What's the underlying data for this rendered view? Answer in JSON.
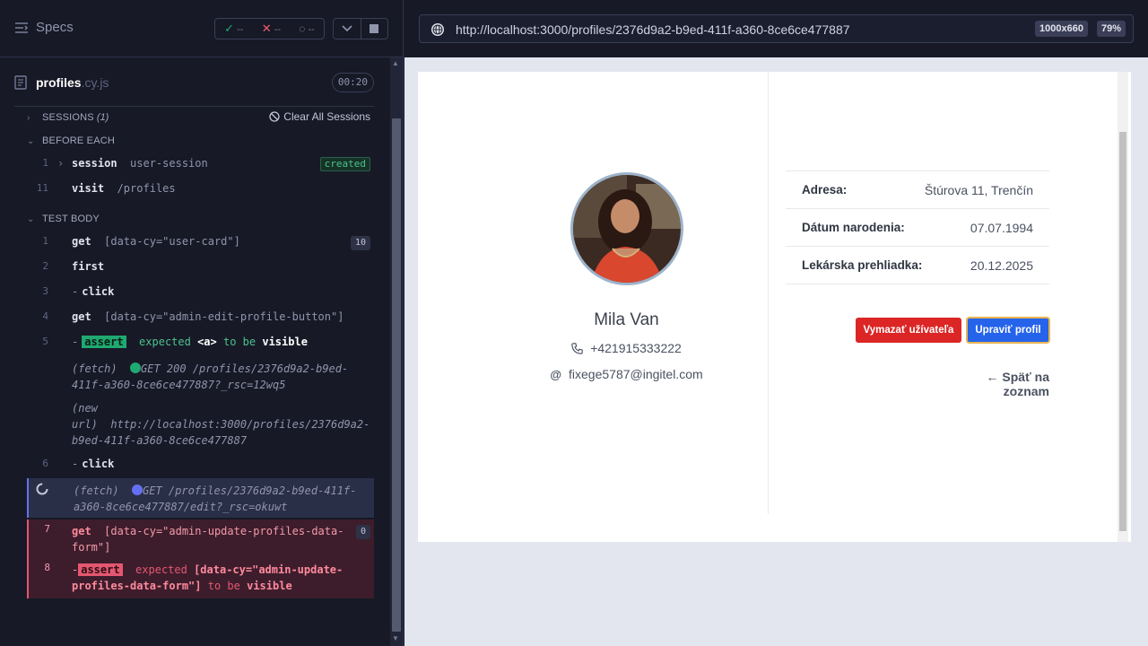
{
  "runner": {
    "specs_label": "Specs",
    "stats": {
      "passed": "--",
      "failed": "--",
      "pending": "--"
    },
    "spec": {
      "name": "profiles",
      "ext": ".cy.js",
      "time": "00:20"
    },
    "sessions": {
      "label": "SESSIONS",
      "count": "(1)",
      "clear_label": "Clear All Sessions"
    },
    "before_each": {
      "label": "BEFORE EACH",
      "commands": [
        {
          "num": "1",
          "cmd": "session",
          "arg": "user-session",
          "badge": "created"
        },
        {
          "num": "11",
          "cmd": "visit",
          "arg": "/profiles"
        }
      ]
    },
    "test_body": {
      "label": "TEST BODY",
      "c1": {
        "num": "1",
        "cmd": "get",
        "arg": "[data-cy=\"user-card\"]",
        "count": "10"
      },
      "c2": {
        "num": "2",
        "cmd": "first"
      },
      "c3": {
        "num": "3",
        "dash": "-",
        "cmd": "click"
      },
      "c4": {
        "num": "4",
        "cmd": "get",
        "arg": "[data-cy=\"admin-edit-profile-button\"]"
      },
      "c5": {
        "num": "5",
        "dash": "-",
        "assert": "assert",
        "expected": "expected",
        "el": "<a>",
        "tobe": "to be",
        "state": "visible"
      },
      "fetch1": {
        "type": "(fetch)",
        "text": "GET 200 /profiles/2376d9a2-b9ed-411f-a360-8ce6ce477887?_rsc=12wq5"
      },
      "newurl": {
        "type": "(new url)",
        "text": "http://localhost:3000/profiles/2376d9a2-b9ed-411f-a360-8ce6ce477887"
      },
      "c6": {
        "num": "6",
        "dash": "-",
        "cmd": "click"
      },
      "fetch2": {
        "type": "(fetch)",
        "text": "GET /profiles/2376d9a2-b9ed-411f-a360-8ce6ce477887/edit?_rsc=okuwt"
      },
      "c7": {
        "num": "7",
        "cmd": "get",
        "arg": "[data-cy=\"admin-update-profiles-data-form\"]",
        "count": "0"
      },
      "c8": {
        "num": "8",
        "dash": "-",
        "assert": "assert",
        "expected": "expected",
        "el": "[data-cy=\"admin-update-profiles-data-form\"]",
        "tobe": "to be",
        "state": "visible"
      }
    }
  },
  "preview": {
    "url": "http://localhost:3000/profiles/2376d9a2-b9ed-411f-a360-8ce6ce477887",
    "viewport": "1000x660",
    "zoom": "79%",
    "profile": {
      "name": "Mila Van",
      "phone": "+421915333222",
      "email": "fixege5787@ingitel.com",
      "info": [
        {
          "label": "Adresa:",
          "value": "Štúrova 11, Trenčín"
        },
        {
          "label": "Dátum narodenia:",
          "value": "07.07.1994"
        },
        {
          "label": "Lekárska prehliadka:",
          "value": "20.12.2025"
        }
      ],
      "delete_label": "Vymazať užívateľa",
      "edit_label": "Upraviť profil",
      "back_label": "← Späť na zoznam"
    }
  },
  "colors": {
    "pass": "#1fa971",
    "fail": "#e45770",
    "running": "#6470f3",
    "primary": "#2563eb",
    "danger": "#dc2626"
  }
}
